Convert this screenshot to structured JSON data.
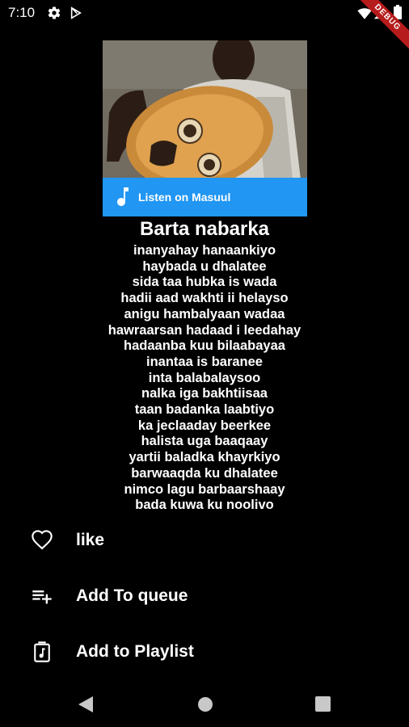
{
  "status_bar": {
    "time": "7:10",
    "debug_label": "DEBUG",
    "icons": [
      "gear-icon",
      "play-store-icon",
      "wifi-icon",
      "signal-icon",
      "battery-icon"
    ]
  },
  "artwork": {
    "listen_label": "Listen on Masuul",
    "banner_color": "#2196f3"
  },
  "song": {
    "title": "Barta nabarka",
    "lyrics": [
      "inanyahay hanaankiyo",
      "haybada u dhalatee",
      "sida taa hubka is wada",
      "hadii aad wakhti ii helayso",
      "anigu hambalyaan wadaa",
      "hawraarsan hadaad i leedahay",
      "hadaanba kuu bilaabayaa",
      "inantaa is baranee",
      "inta balabalaysoo",
      "nalka iga bakhtiisaa",
      "taan badanka laabtiyo",
      "ka jeclaaday beerkee",
      "halista uga baaqaay",
      "yartii baladka khayrkiyo",
      "barwaaqda ku dhalatee",
      "nimco lagu barbaarshaay",
      "bada kuwa ku noolivo"
    ]
  },
  "actions": {
    "like": "like",
    "queue": "Add To queue",
    "playlist": "Add to Playlist"
  },
  "nav": {
    "icons": [
      "back-icon",
      "home-icon",
      "recents-icon"
    ]
  }
}
